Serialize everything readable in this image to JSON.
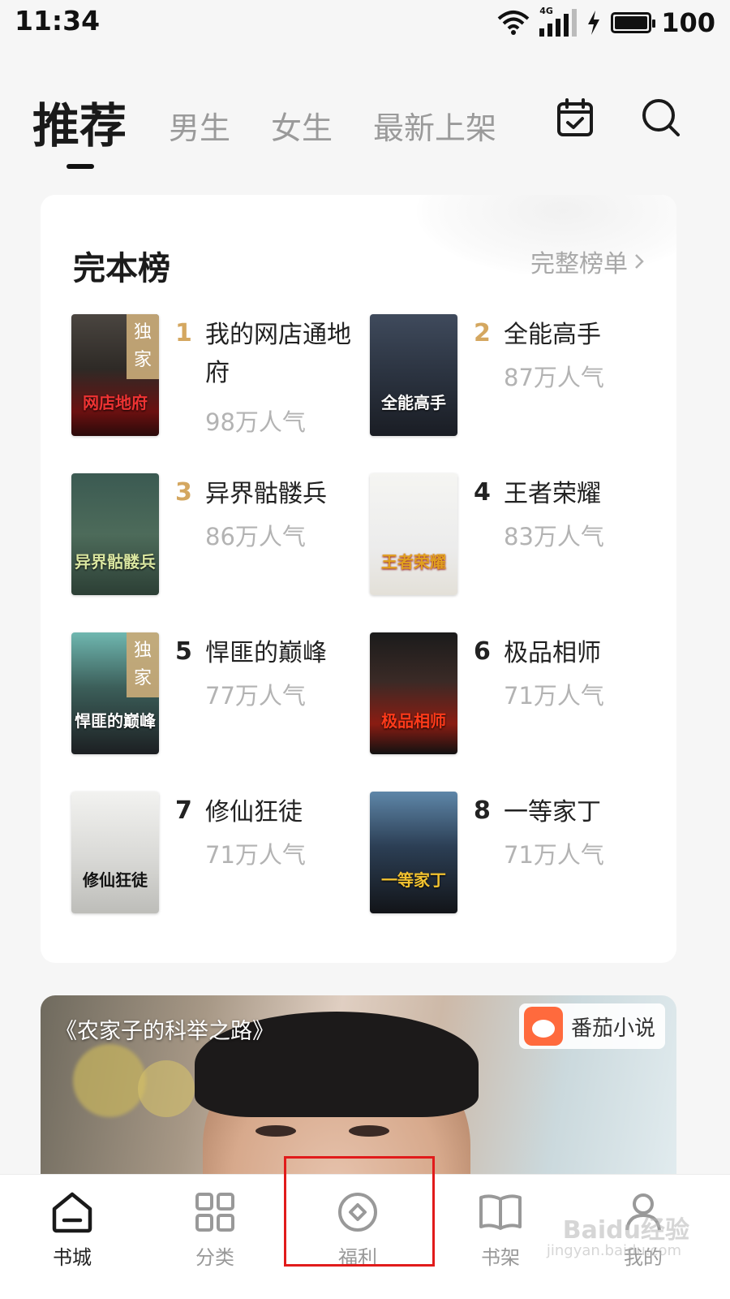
{
  "status_bar": {
    "time": "11:34",
    "network": "4G",
    "battery": "100"
  },
  "tabs": [
    {
      "label": "推荐"
    },
    {
      "label": "男生"
    },
    {
      "label": "女生"
    },
    {
      "label": "最新上架"
    }
  ],
  "header_icons": [
    "calendar-check-icon",
    "search-icon"
  ],
  "ranking": {
    "title": "完本榜",
    "more": "完整榜单",
    "books": [
      {
        "rank": "1",
        "name": "我的网店通地府",
        "popularity": "98万人气",
        "exclusive": true,
        "badge": "独家",
        "cover_text": "网店地府"
      },
      {
        "rank": "2",
        "name": "全能高手",
        "popularity": "87万人气",
        "exclusive": false,
        "badge": "",
        "cover_text": "全能高手"
      },
      {
        "rank": "3",
        "name": "异界骷髅兵",
        "popularity": "86万人气",
        "exclusive": false,
        "badge": "",
        "cover_text": "异界骷髅兵"
      },
      {
        "rank": "4",
        "name": "王者荣耀",
        "popularity": "83万人气",
        "exclusive": false,
        "badge": "",
        "cover_text": "王者荣耀"
      },
      {
        "rank": "5",
        "name": "悍匪的巅峰",
        "popularity": "77万人气",
        "exclusive": true,
        "badge": "独家",
        "cover_text": "悍匪的巅峰"
      },
      {
        "rank": "6",
        "name": "极品相师",
        "popularity": "71万人气",
        "exclusive": false,
        "badge": "",
        "cover_text": "极品相师"
      },
      {
        "rank": "7",
        "name": "修仙狂徒",
        "popularity": "71万人气",
        "exclusive": false,
        "badge": "",
        "cover_text": "修仙狂徒"
      },
      {
        "rank": "8",
        "name": "一等家丁",
        "popularity": "71万人气",
        "exclusive": false,
        "badge": "",
        "cover_text": "一等家丁"
      }
    ]
  },
  "banner": {
    "title": "《农家子的科举之路》",
    "brand": "番茄小说"
  },
  "bottom_nav": [
    {
      "label": "书城",
      "icon": "home-icon",
      "active": true
    },
    {
      "label": "分类",
      "icon": "grid-icon",
      "active": false
    },
    {
      "label": "福利",
      "icon": "diamond-circle-icon",
      "active": false
    },
    {
      "label": "书架",
      "icon": "open-book-icon",
      "active": false
    },
    {
      "label": "我的",
      "icon": "person-icon",
      "active": false
    }
  ],
  "watermark": {
    "main": "Baidu经验",
    "sub": "jingyan.baidu.com"
  },
  "colors": {
    "gold_rank": "#d4a760",
    "highlight": "#e11b1b"
  }
}
